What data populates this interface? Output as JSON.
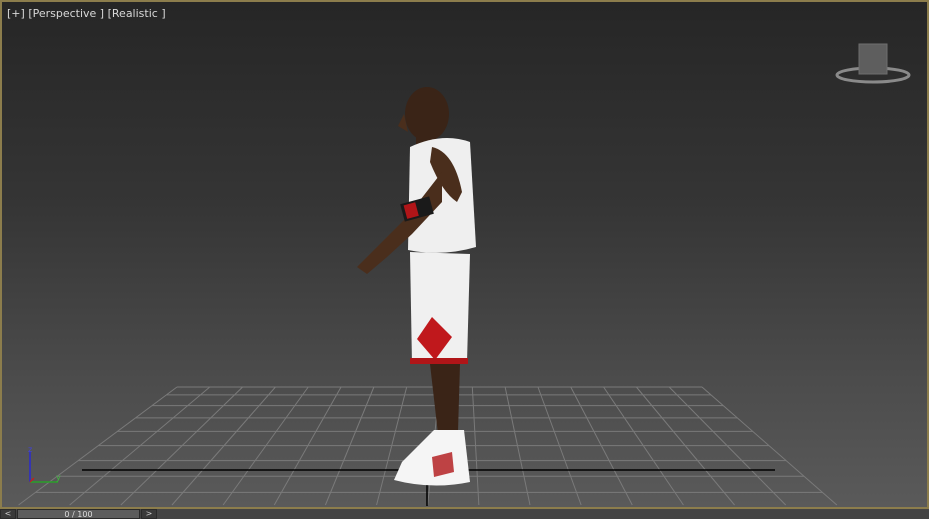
{
  "viewport": {
    "plus": "[+]",
    "view": "[Perspective ]",
    "shading": "[Realistic ]"
  },
  "axis": {
    "z": "z",
    "y": "y",
    "x": "x"
  },
  "timeline": {
    "prev": "<",
    "next": ">",
    "frame": "0 / 100"
  },
  "colors": {
    "border": "#8c7d4c",
    "jersey": "#f2f2f2",
    "accent": "#c0181c"
  }
}
